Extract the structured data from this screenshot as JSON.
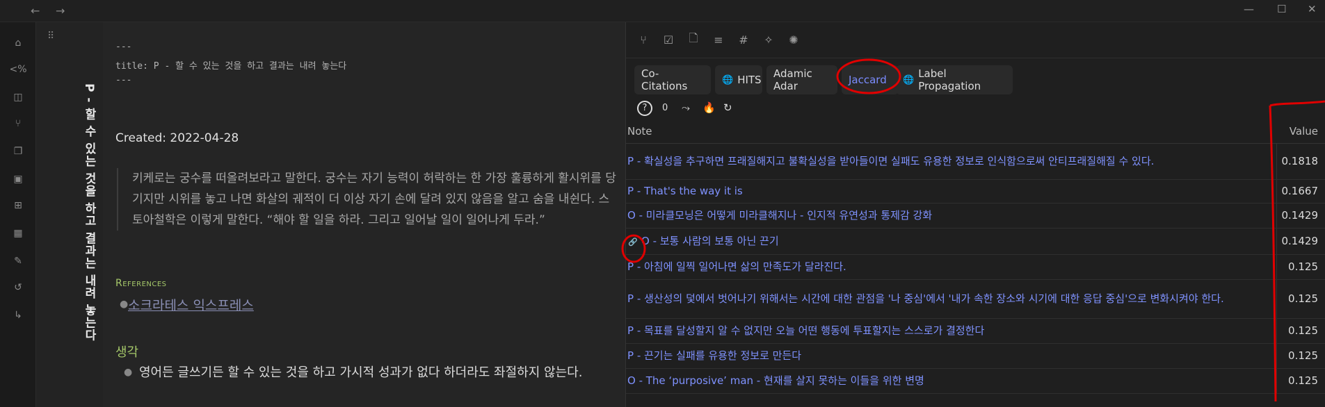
{
  "titlebar": {
    "back": "←",
    "forward": "→",
    "minimize": "—",
    "maximize": "☐",
    "close": "✕"
  },
  "ribbon": {
    "icons": [
      "home-icon",
      "template-icon",
      "search-icon",
      "graph-icon",
      "pages-icon",
      "terminal-icon",
      "grid-icon",
      "calendar-icon",
      "brush-icon",
      "history-icon",
      "branch-icon"
    ],
    "glyphs": [
      "⌂",
      "<%",
      "◫",
      "⑂",
      "❐",
      "▣",
      "⊞",
      "▦",
      "✎",
      "↺",
      "↳"
    ]
  },
  "note_title": "P - 할 수 있는 것을 하고 결과는 내려 놓는다",
  "editor": {
    "frontmatter_open": "---",
    "frontmatter_title": "title: P - 할 수 있는 것을 하고 결과는 내려 놓는다",
    "frontmatter_close": "---",
    "created": "Created: 2022-04-28",
    "quote": "키케로는 궁수를 떠올려보라고 말한다. 궁수는 자기 능력이 허락하는 한 가장 훌륭하게 활시위를 당기지만 시위를 놓고 나면 화살의 궤적이 더 이상 자기 손에 달려 있지 않음을 알고 숨을 내쉰다. 스토아철학은 이렇게 말한다. “해야 할 일을 하라. 그리고 일어날 일이 일어나게 두라.”",
    "references_heading": "References",
    "reference_link": "소크라테스 익스프레스",
    "thought_heading": "생각",
    "thought_body": "영어든 글쓰기든 할 수 있는 것을 하고 가시적 성과가 없다 하더라도 좌절하지 않는다."
  },
  "panel": {
    "toolbar_icons": [
      "graph-view-icon",
      "tasks-icon",
      "file-icon",
      "list-icon",
      "tag-icon",
      "wand-icon",
      "network-icon"
    ],
    "toolbar_glyphs": [
      "⑂",
      "☑",
      "🗋",
      "≡",
      "#",
      "✧",
      "✺"
    ],
    "tabs": [
      {
        "label": "Co-Citations",
        "icon": ""
      },
      {
        "label": "HITS",
        "icon": "🌐"
      },
      {
        "label": "Adamic Adar",
        "icon": ""
      },
      {
        "label": "Jaccard",
        "icon": ""
      },
      {
        "label": "Label Propagation",
        "icon": "🌐"
      }
    ],
    "active_tab": "Jaccard",
    "controls": {
      "help": "?",
      "count": "0",
      "trend": "⤳",
      "fire": "🔥",
      "refresh": "↻"
    },
    "columns": {
      "note": "Note",
      "value": "Value"
    },
    "rows": [
      {
        "note": "P - 확실성을 추구하면 프래질해지고 불확실성을 받아들이면 실패도 유용한 정보로 인식함으로써 안티프래질해질 수 있다.",
        "value": "0.1818"
      },
      {
        "note": "P - That's the way it is",
        "value": "0.1667"
      },
      {
        "note": "O - 미라클모닝은 어떻게 미라클해지나 - 인지적 유연성과 통제감 강화",
        "value": "0.1429"
      },
      {
        "note": "O - 보통 사람의 보통 아닌 끈기",
        "value": "0.1429"
      },
      {
        "note": "P - 아침에 일찍 일어나면 삶의 만족도가 달라진다.",
        "value": "0.125"
      },
      {
        "note": "P - 생산성의 덫에서 벗어나기 위해서는 시간에 대한 관점을 '나 중심'에서 '내가 속한 장소와 시기에 대한 응답 중심'으로 변화시켜야 한다.",
        "value": "0.125"
      },
      {
        "note": "P - 목표를 달성할지 알 수 없지만 오늘 어떤 행동에 투표할지는 스스로가 결정한다",
        "value": "0.125"
      },
      {
        "note": "P - 끈기는 실패를 유용한 정보로 만든다",
        "value": "0.125"
      },
      {
        "note": "O - The ‘purposive’ man - 현재를 살지 못하는 이들을 위한 변명",
        "value": "0.125"
      }
    ]
  },
  "colors": {
    "link": "#7f92ff",
    "annotation": "#e00000",
    "accent_green": "#a6c96a"
  }
}
